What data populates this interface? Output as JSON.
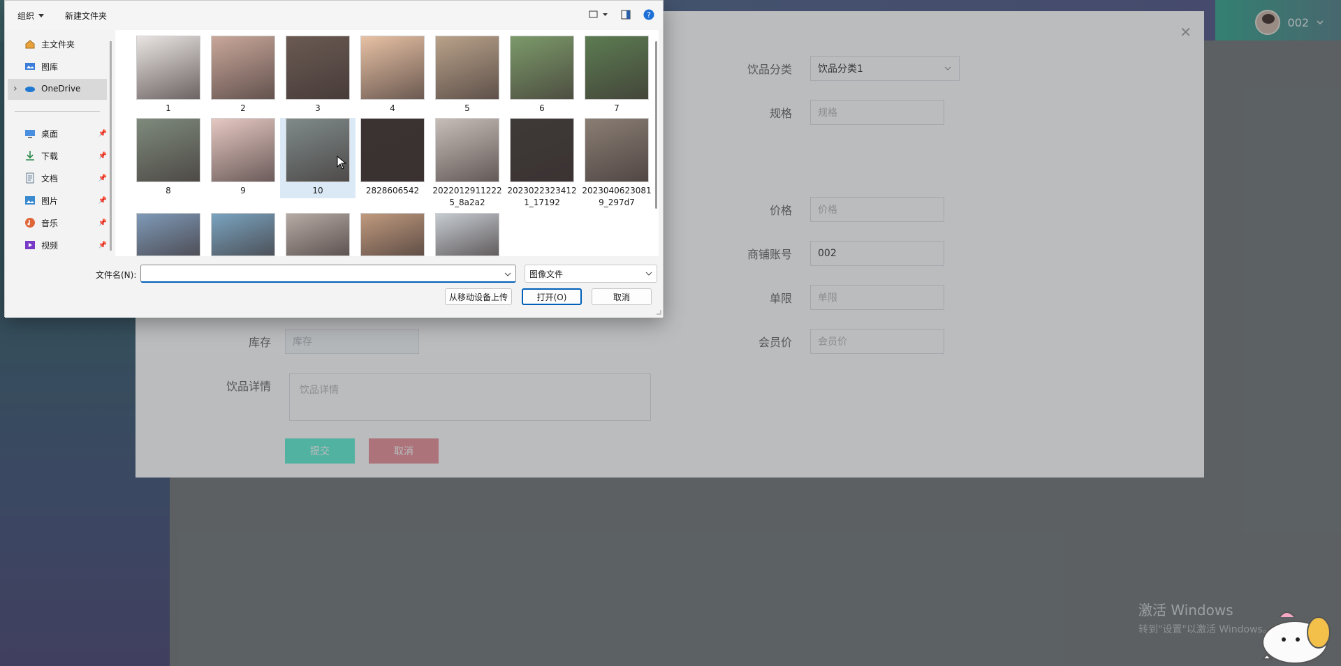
{
  "header": {
    "username": "002"
  },
  "system_watermark": {
    "title": "激活 Windows",
    "subtitle": "转到\"设置\"以激活 Windows。"
  },
  "form": {
    "category_label": "饮品分类",
    "category_value": "饮品分类1",
    "spec_label": "规格",
    "spec_placeholder": "规格",
    "price_label": "价格",
    "price_placeholder": "价格",
    "shop_account_label": "商铺账号",
    "shop_account_value": "002",
    "limit_label": "单限",
    "limit_placeholder": "单限",
    "member_price_label": "会员价",
    "member_price_placeholder": "会员价",
    "stock_label": "库存",
    "stock_placeholder": "库存",
    "detail_label": "饮品详情",
    "detail_placeholder": "饮品详情",
    "submit_label": "提交",
    "cancel_label": "取消"
  },
  "colors": {
    "submit": "#5ff0d4",
    "cancel": "#e8909a",
    "accent": "#005fb8"
  },
  "file_dialog": {
    "toolbar": {
      "organize": "组织",
      "new_folder": "新建文件夹"
    },
    "nav": [
      {
        "label": "主文件夹",
        "icon": "home-icon"
      },
      {
        "label": "图库",
        "icon": "gallery-icon"
      },
      {
        "label": "OneDrive",
        "icon": "cloud-icon"
      },
      {
        "label": "桌面",
        "icon": "desktop-icon"
      },
      {
        "label": "下载",
        "icon": "download-icon"
      },
      {
        "label": "文档",
        "icon": "document-icon"
      },
      {
        "label": "图片",
        "icon": "pictures-icon"
      },
      {
        "label": "音乐",
        "icon": "music-icon"
      },
      {
        "label": "视频",
        "icon": "video-icon"
      }
    ],
    "files": [
      {
        "name": "1",
        "color": "#e9e4e2"
      },
      {
        "name": "2",
        "color": "#c9a79a"
      },
      {
        "name": "3",
        "color": "#6a5a52"
      },
      {
        "name": "4",
        "color": "#e7c1a4"
      },
      {
        "name": "5",
        "color": "#b9a28a"
      },
      {
        "name": "6",
        "color": "#7c9a6a"
      },
      {
        "name": "7",
        "color": "#5c7c52"
      },
      {
        "name": "8",
        "color": "#7e8a7c"
      },
      {
        "name": "9",
        "color": "#e6c8c2"
      },
      {
        "name": "10",
        "color": "#7f8b8a"
      },
      {
        "name": "2828606542",
        "color": "#3b3232"
      },
      {
        "name": "2022012911222\n5_8a2a2",
        "color": "#c8beb8"
      },
      {
        "name": "2023022323412\n1_17192",
        "color": "#3e3a38"
      },
      {
        "name": "2023040623081\n9_297d7",
        "color": "#8a7e74"
      },
      {
        "name": "",
        "color": "#7f9ab8"
      },
      {
        "name": "",
        "color": "#7aa4c0"
      },
      {
        "name": "",
        "color": "#b6aba4"
      },
      {
        "name": "",
        "color": "#c09a7e"
      },
      {
        "name": "",
        "color": "#c6ccd2"
      }
    ],
    "filename_label": "文件名(N):",
    "filename_value": "",
    "filetype_value": "图像文件",
    "upload_mobile_label": "从移动设备上传",
    "open_label": "打开(O)",
    "cancel_label": "取消"
  }
}
